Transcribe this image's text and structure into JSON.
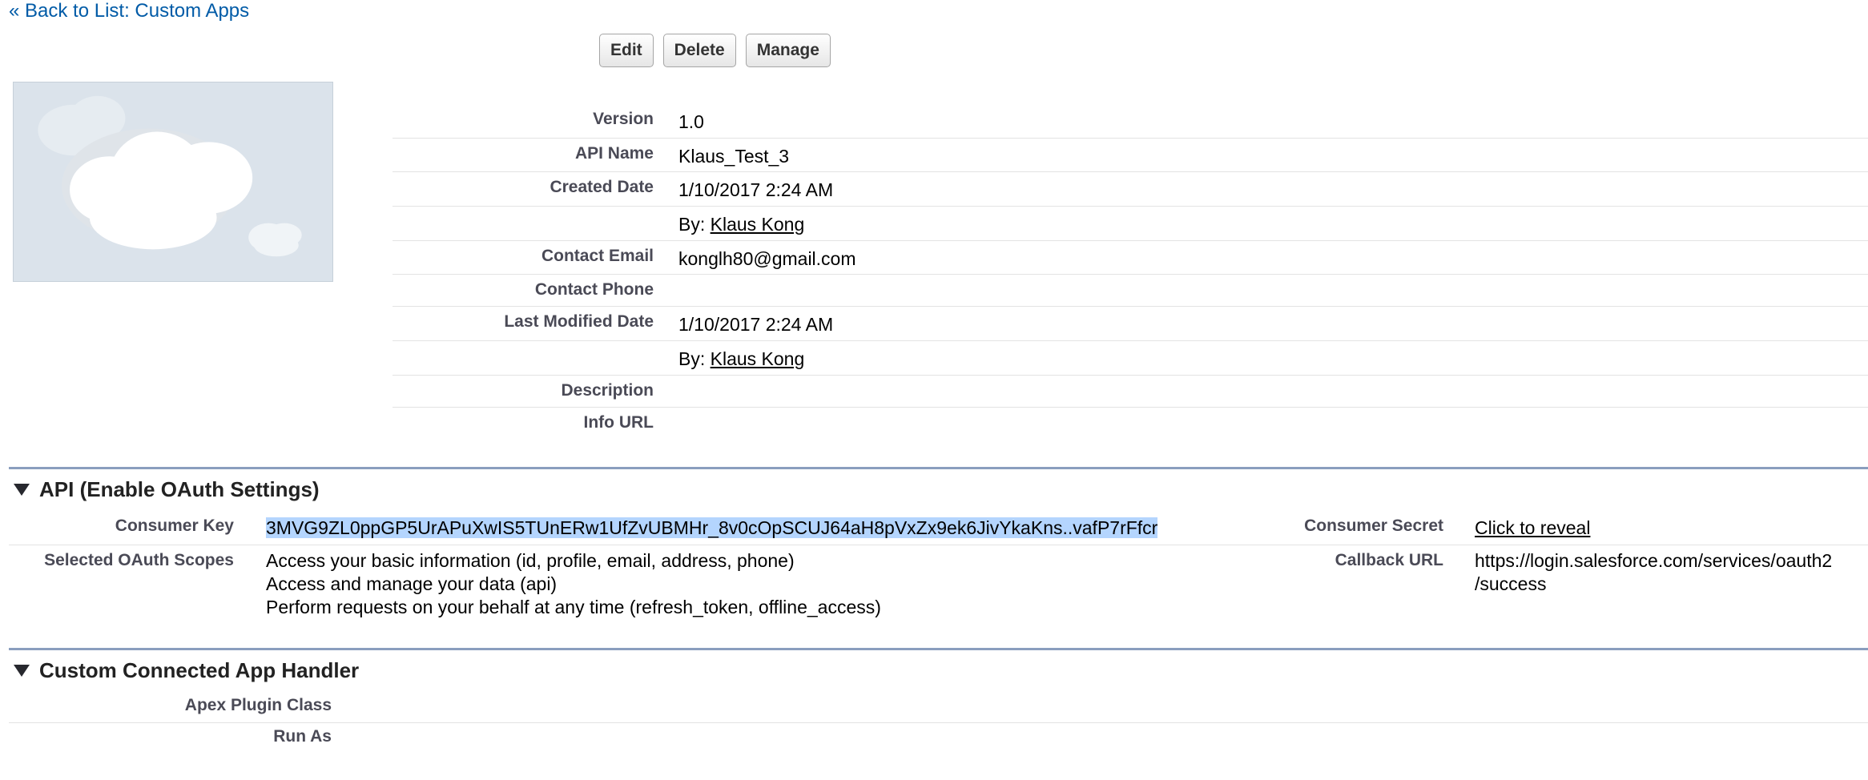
{
  "back_link": "« Back to List: Custom Apps",
  "buttons": {
    "edit": "Edit",
    "delete": "Delete",
    "manage": "Manage"
  },
  "details": {
    "version_label": "Version",
    "version": "1.0",
    "api_name_label": "API Name",
    "api_name": "Klaus_Test_3",
    "created_date_label": "Created Date",
    "created_date": "1/10/2017 2:24 AM",
    "created_by_prefix": "By: ",
    "created_by": "Klaus Kong",
    "contact_email_label": "Contact Email",
    "contact_email": "konglh80@gmail.com",
    "contact_phone_label": "Contact Phone",
    "last_modified_label": "Last Modified Date",
    "last_modified": "1/10/2017 2:24 AM",
    "modified_by_prefix": "By: ",
    "modified_by": "Klaus Kong",
    "description_label": "Description",
    "info_url_label": "Info URL"
  },
  "api_section": {
    "title": "API (Enable OAuth Settings)",
    "consumer_key_label": "Consumer Key",
    "consumer_key": "3MVG9ZL0ppGP5UrAPuXwIS5TUnERw1UfZvUBMHr_8v0cOpSCUJ64aH8pVxZx9ek6JivYkaKns..vafP7rFfcr",
    "consumer_secret_label": "Consumer Secret",
    "consumer_secret_link": "Click to reveal",
    "scopes_label": "Selected OAuth Scopes",
    "scopes": [
      "Access your basic information (id, profile, email, address, phone)",
      "Access and manage your data (api)",
      "Perform requests on your behalf at any time (refresh_token, offline_access)"
    ],
    "callback_label": "Callback URL",
    "callback_url_line1": "https://login.salesforce.com/services/oauth2",
    "callback_url_line2": "/success"
  },
  "handler_section": {
    "title": "Custom Connected App Handler",
    "apex_plugin_label": "Apex Plugin Class",
    "run_as_label": "Run As"
  },
  "colors": {
    "link": "#015ba7",
    "section_rule": "#8a9ebe",
    "highlight": "#b4d5fe",
    "logo_bg": "#dbe3eb"
  }
}
